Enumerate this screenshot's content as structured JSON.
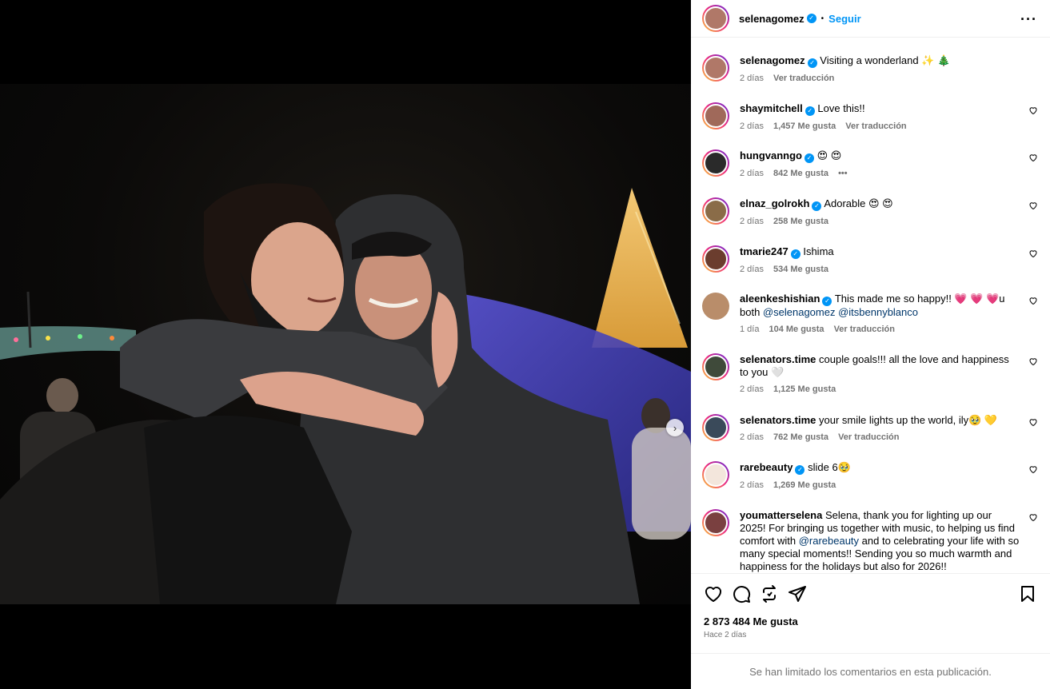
{
  "post": {
    "author": "selenagomez",
    "follow_label": "Seguir",
    "caption": "Visiting a wonderland ✨ 🎄",
    "caption_time": "2 días",
    "translate_label": "Ver traducción",
    "likes": "2 873 484 Me gusta",
    "posted_time": "Hace 2 días",
    "comments_limited": "Se han limitado los comentarios en esta publicación.",
    "slides_total": 12,
    "slide_active": 1
  },
  "comments": [
    {
      "user": "shaymitchell",
      "verified": true,
      "text": "Love this!!",
      "time": "2 días",
      "likes": "1,457 Me gusta",
      "action": "Ver traducción",
      "avatar": "#a0695a"
    },
    {
      "user": "hungvanngo",
      "verified": true,
      "text": "😍 😍",
      "time": "2 días",
      "likes": "842 Me gusta",
      "action": "•••",
      "avatar": "#2a2a2a"
    },
    {
      "user": "elnaz_golrokh",
      "verified": true,
      "text": "Adorable 😍 😍",
      "time": "2 días",
      "likes": "258 Me gusta",
      "action": "",
      "avatar": "#8a6c48"
    },
    {
      "user": "tmarie247",
      "verified": true,
      "text": "Ishima",
      "time": "2 días",
      "likes": "534 Me gusta",
      "action": "",
      "avatar": "#6b3d2e"
    },
    {
      "user": "aleenkeshishian",
      "verified": true,
      "text": "This made me so happy!! 💗 💗 💗u both",
      "mentions": "@selenagomez @itsbennyblanco",
      "time": "1 día",
      "likes": "104 Me gusta",
      "action": "Ver traducción",
      "avatar": "#b98d6a"
    },
    {
      "user": "selenators.time",
      "verified": false,
      "text": "couple goals!!! all the love and happiness to you 🤍",
      "time": "2 días",
      "likes": "1,125 Me gusta",
      "action": "",
      "avatar": "#3f4a3a"
    },
    {
      "user": "selenators.time",
      "verified": false,
      "text": "your smile lights up the world, ily🥹 💛",
      "time": "2 días",
      "likes": "762 Me gusta",
      "action": "Ver traducción",
      "avatar": "#3a4a5a"
    },
    {
      "user": "rarebeauty",
      "verified": true,
      "text": "slide 6🥹",
      "time": "2 días",
      "likes": "1,269 Me gusta",
      "action": "",
      "avatar": "#f3e6dc"
    },
    {
      "user": "youmatterselena",
      "verified": false,
      "text_before": "Selena, thank you for lighting up our 2025! For bringing us together with music, to helping us find comfort with ",
      "mention": "@rarebeauty",
      "text_after": " and to celebrating your life with so many special moments!! Sending you so much warmth and happiness for the holidays but also for 2026!!",
      "avatar": "#7a4040"
    }
  ]
}
